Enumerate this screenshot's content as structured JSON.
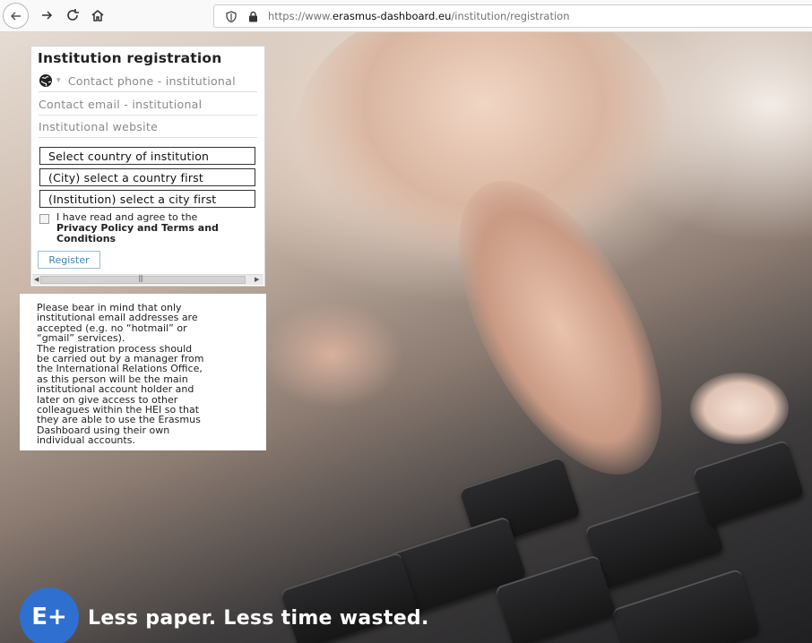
{
  "browser": {
    "url_prefix": "https://www.",
    "url_domain": "erasmus-dashboard.eu",
    "url_path": "/institution/registration",
    "icons": [
      "back-icon",
      "forward-icon",
      "reload-icon",
      "home-icon",
      "shield-icon",
      "lock-icon"
    ]
  },
  "registration": {
    "title": "Institution registration",
    "phone_placeholder": "Contact phone - institutional",
    "email_placeholder": "Contact email - institutional",
    "website_placeholder": "Institutional website",
    "country_select": "Select country of institution",
    "city_select": "(City) select a country first",
    "institution_select": "(Institution) select a city first",
    "agree_prefix": "I have read and agree to the",
    "agree_link": "Privacy Policy and Terms and Conditions",
    "register_label": "Register"
  },
  "info": {
    "text": "Please bear in mind that only\ninstitutional email addresses are\naccepted (e.g. no “hotmail” or\n“gmail” services).\nThe registration process should\nbe carried out by a manager from\nthe International Relations Office,\nas this person will be the main\ninstitutional account holder and\nlater on give access to other\ncolleagues within the HEI so that\nthey are able to use the Erasmus\nDashboard using their own\nindividual accounts."
  },
  "footer": {
    "logo_text": "E+",
    "slogan": "Less paper. Less time wasted."
  },
  "colors": {
    "logo_blue": "#2e6fd0",
    "link_blue": "#3a84b7"
  }
}
